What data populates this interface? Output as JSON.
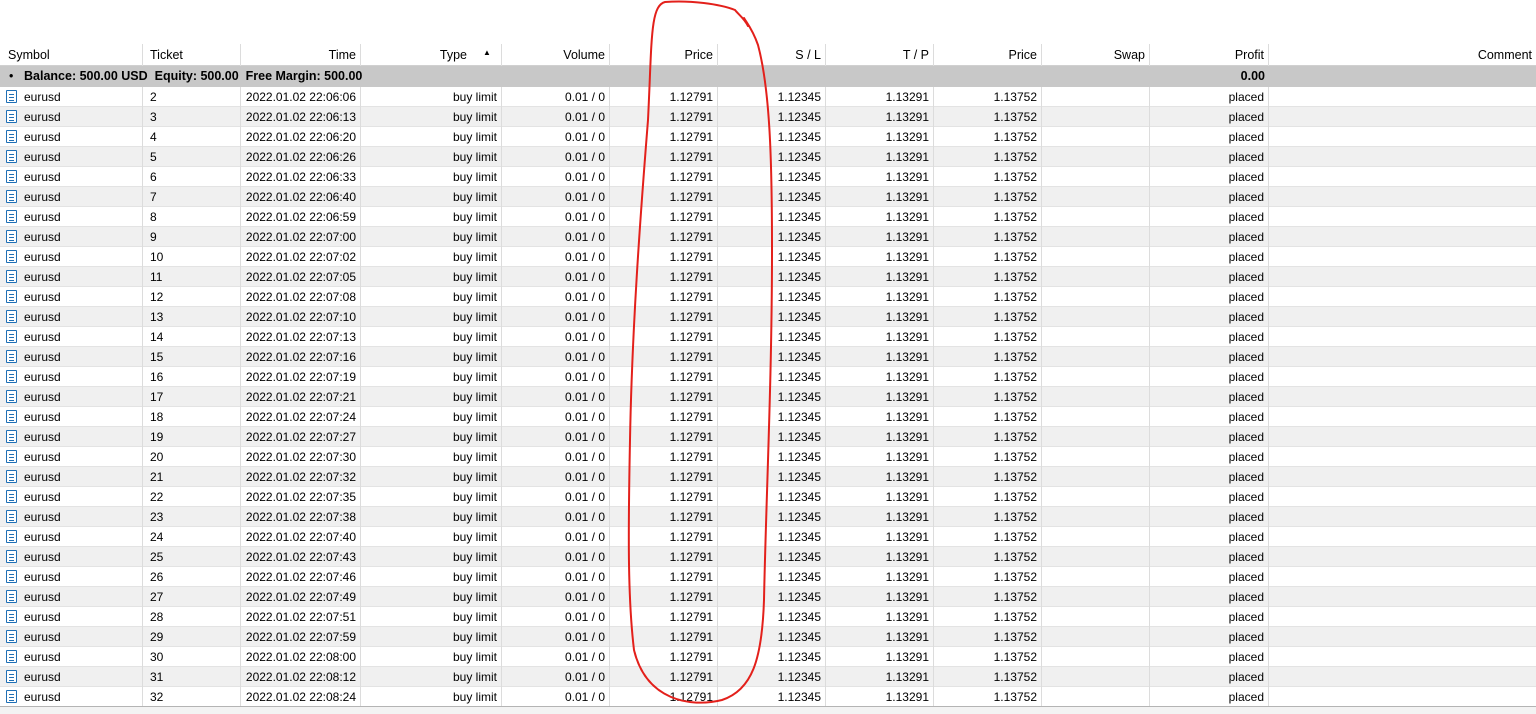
{
  "columns": {
    "symbol": "Symbol",
    "ticket": "Ticket",
    "time": "Time",
    "type": "Type",
    "volume": "Volume",
    "price": "Price",
    "sl": "S / L",
    "tp": "T / P",
    "price2": "Price",
    "swap": "Swap",
    "profit": "Profit",
    "comment": "Comment"
  },
  "summary": {
    "text": "Balance: 500.00 USD  Equity: 500.00  Free Margin: 500.00",
    "profit": "0.00"
  },
  "icons": {
    "row": "pending-order-icon",
    "bullet": "bullet-icon",
    "sort": "sort-ascending-icon"
  },
  "annotation_color": "#e3201b",
  "rows": [
    {
      "symbol": "eurusd",
      "ticket": "2",
      "time": "2022.01.02 22:06:06",
      "type": "buy limit",
      "volume": "0.01 / 0",
      "price": "1.12791",
      "sl": "1.12345",
      "tp": "1.13291",
      "price2": "1.13752",
      "swap": "",
      "profit": "placed",
      "comment": ""
    },
    {
      "symbol": "eurusd",
      "ticket": "3",
      "time": "2022.01.02 22:06:13",
      "type": "buy limit",
      "volume": "0.01 / 0",
      "price": "1.12791",
      "sl": "1.12345",
      "tp": "1.13291",
      "price2": "1.13752",
      "swap": "",
      "profit": "placed",
      "comment": ""
    },
    {
      "symbol": "eurusd",
      "ticket": "4",
      "time": "2022.01.02 22:06:20",
      "type": "buy limit",
      "volume": "0.01 / 0",
      "price": "1.12791",
      "sl": "1.12345",
      "tp": "1.13291",
      "price2": "1.13752",
      "swap": "",
      "profit": "placed",
      "comment": ""
    },
    {
      "symbol": "eurusd",
      "ticket": "5",
      "time": "2022.01.02 22:06:26",
      "type": "buy limit",
      "volume": "0.01 / 0",
      "price": "1.12791",
      "sl": "1.12345",
      "tp": "1.13291",
      "price2": "1.13752",
      "swap": "",
      "profit": "placed",
      "comment": ""
    },
    {
      "symbol": "eurusd",
      "ticket": "6",
      "time": "2022.01.02 22:06:33",
      "type": "buy limit",
      "volume": "0.01 / 0",
      "price": "1.12791",
      "sl": "1.12345",
      "tp": "1.13291",
      "price2": "1.13752",
      "swap": "",
      "profit": "placed",
      "comment": ""
    },
    {
      "symbol": "eurusd",
      "ticket": "7",
      "time": "2022.01.02 22:06:40",
      "type": "buy limit",
      "volume": "0.01 / 0",
      "price": "1.12791",
      "sl": "1.12345",
      "tp": "1.13291",
      "price2": "1.13752",
      "swap": "",
      "profit": "placed",
      "comment": ""
    },
    {
      "symbol": "eurusd",
      "ticket": "8",
      "time": "2022.01.02 22:06:59",
      "type": "buy limit",
      "volume": "0.01 / 0",
      "price": "1.12791",
      "sl": "1.12345",
      "tp": "1.13291",
      "price2": "1.13752",
      "swap": "",
      "profit": "placed",
      "comment": ""
    },
    {
      "symbol": "eurusd",
      "ticket": "9",
      "time": "2022.01.02 22:07:00",
      "type": "buy limit",
      "volume": "0.01 / 0",
      "price": "1.12791",
      "sl": "1.12345",
      "tp": "1.13291",
      "price2": "1.13752",
      "swap": "",
      "profit": "placed",
      "comment": ""
    },
    {
      "symbol": "eurusd",
      "ticket": "10",
      "time": "2022.01.02 22:07:02",
      "type": "buy limit",
      "volume": "0.01 / 0",
      "price": "1.12791",
      "sl": "1.12345",
      "tp": "1.13291",
      "price2": "1.13752",
      "swap": "",
      "profit": "placed",
      "comment": ""
    },
    {
      "symbol": "eurusd",
      "ticket": "11",
      "time": "2022.01.02 22:07:05",
      "type": "buy limit",
      "volume": "0.01 / 0",
      "price": "1.12791",
      "sl": "1.12345",
      "tp": "1.13291",
      "price2": "1.13752",
      "swap": "",
      "profit": "placed",
      "comment": ""
    },
    {
      "symbol": "eurusd",
      "ticket": "12",
      "time": "2022.01.02 22:07:08",
      "type": "buy limit",
      "volume": "0.01 / 0",
      "price": "1.12791",
      "sl": "1.12345",
      "tp": "1.13291",
      "price2": "1.13752",
      "swap": "",
      "profit": "placed",
      "comment": ""
    },
    {
      "symbol": "eurusd",
      "ticket": "13",
      "time": "2022.01.02 22:07:10",
      "type": "buy limit",
      "volume": "0.01 / 0",
      "price": "1.12791",
      "sl": "1.12345",
      "tp": "1.13291",
      "price2": "1.13752",
      "swap": "",
      "profit": "placed",
      "comment": ""
    },
    {
      "symbol": "eurusd",
      "ticket": "14",
      "time": "2022.01.02 22:07:13",
      "type": "buy limit",
      "volume": "0.01 / 0",
      "price": "1.12791",
      "sl": "1.12345",
      "tp": "1.13291",
      "price2": "1.13752",
      "swap": "",
      "profit": "placed",
      "comment": ""
    },
    {
      "symbol": "eurusd",
      "ticket": "15",
      "time": "2022.01.02 22:07:16",
      "type": "buy limit",
      "volume": "0.01 / 0",
      "price": "1.12791",
      "sl": "1.12345",
      "tp": "1.13291",
      "price2": "1.13752",
      "swap": "",
      "profit": "placed",
      "comment": ""
    },
    {
      "symbol": "eurusd",
      "ticket": "16",
      "time": "2022.01.02 22:07:19",
      "type": "buy limit",
      "volume": "0.01 / 0",
      "price": "1.12791",
      "sl": "1.12345",
      "tp": "1.13291",
      "price2": "1.13752",
      "swap": "",
      "profit": "placed",
      "comment": ""
    },
    {
      "symbol": "eurusd",
      "ticket": "17",
      "time": "2022.01.02 22:07:21",
      "type": "buy limit",
      "volume": "0.01 / 0",
      "price": "1.12791",
      "sl": "1.12345",
      "tp": "1.13291",
      "price2": "1.13752",
      "swap": "",
      "profit": "placed",
      "comment": ""
    },
    {
      "symbol": "eurusd",
      "ticket": "18",
      "time": "2022.01.02 22:07:24",
      "type": "buy limit",
      "volume": "0.01 / 0",
      "price": "1.12791",
      "sl": "1.12345",
      "tp": "1.13291",
      "price2": "1.13752",
      "swap": "",
      "profit": "placed",
      "comment": ""
    },
    {
      "symbol": "eurusd",
      "ticket": "19",
      "time": "2022.01.02 22:07:27",
      "type": "buy limit",
      "volume": "0.01 / 0",
      "price": "1.12791",
      "sl": "1.12345",
      "tp": "1.13291",
      "price2": "1.13752",
      "swap": "",
      "profit": "placed",
      "comment": ""
    },
    {
      "symbol": "eurusd",
      "ticket": "20",
      "time": "2022.01.02 22:07:30",
      "type": "buy limit",
      "volume": "0.01 / 0",
      "price": "1.12791",
      "sl": "1.12345",
      "tp": "1.13291",
      "price2": "1.13752",
      "swap": "",
      "profit": "placed",
      "comment": ""
    },
    {
      "symbol": "eurusd",
      "ticket": "21",
      "time": "2022.01.02 22:07:32",
      "type": "buy limit",
      "volume": "0.01 / 0",
      "price": "1.12791",
      "sl": "1.12345",
      "tp": "1.13291",
      "price2": "1.13752",
      "swap": "",
      "profit": "placed",
      "comment": ""
    },
    {
      "symbol": "eurusd",
      "ticket": "22",
      "time": "2022.01.02 22:07:35",
      "type": "buy limit",
      "volume": "0.01 / 0",
      "price": "1.12791",
      "sl": "1.12345",
      "tp": "1.13291",
      "price2": "1.13752",
      "swap": "",
      "profit": "placed",
      "comment": ""
    },
    {
      "symbol": "eurusd",
      "ticket": "23",
      "time": "2022.01.02 22:07:38",
      "type": "buy limit",
      "volume": "0.01 / 0",
      "price": "1.12791",
      "sl": "1.12345",
      "tp": "1.13291",
      "price2": "1.13752",
      "swap": "",
      "profit": "placed",
      "comment": ""
    },
    {
      "symbol": "eurusd",
      "ticket": "24",
      "time": "2022.01.02 22:07:40",
      "type": "buy limit",
      "volume": "0.01 / 0",
      "price": "1.12791",
      "sl": "1.12345",
      "tp": "1.13291",
      "price2": "1.13752",
      "swap": "",
      "profit": "placed",
      "comment": ""
    },
    {
      "symbol": "eurusd",
      "ticket": "25",
      "time": "2022.01.02 22:07:43",
      "type": "buy limit",
      "volume": "0.01 / 0",
      "price": "1.12791",
      "sl": "1.12345",
      "tp": "1.13291",
      "price2": "1.13752",
      "swap": "",
      "profit": "placed",
      "comment": ""
    },
    {
      "symbol": "eurusd",
      "ticket": "26",
      "time": "2022.01.02 22:07:46",
      "type": "buy limit",
      "volume": "0.01 / 0",
      "price": "1.12791",
      "sl": "1.12345",
      "tp": "1.13291",
      "price2": "1.13752",
      "swap": "",
      "profit": "placed",
      "comment": ""
    },
    {
      "symbol": "eurusd",
      "ticket": "27",
      "time": "2022.01.02 22:07:49",
      "type": "buy limit",
      "volume": "0.01 / 0",
      "price": "1.12791",
      "sl": "1.12345",
      "tp": "1.13291",
      "price2": "1.13752",
      "swap": "",
      "profit": "placed",
      "comment": ""
    },
    {
      "symbol": "eurusd",
      "ticket": "28",
      "time": "2022.01.02 22:07:51",
      "type": "buy limit",
      "volume": "0.01 / 0",
      "price": "1.12791",
      "sl": "1.12345",
      "tp": "1.13291",
      "price2": "1.13752",
      "swap": "",
      "profit": "placed",
      "comment": ""
    },
    {
      "symbol": "eurusd",
      "ticket": "29",
      "time": "2022.01.02 22:07:59",
      "type": "buy limit",
      "volume": "0.01 / 0",
      "price": "1.12791",
      "sl": "1.12345",
      "tp": "1.13291",
      "price2": "1.13752",
      "swap": "",
      "profit": "placed",
      "comment": ""
    },
    {
      "symbol": "eurusd",
      "ticket": "30",
      "time": "2022.01.02 22:08:00",
      "type": "buy limit",
      "volume": "0.01 / 0",
      "price": "1.12791",
      "sl": "1.12345",
      "tp": "1.13291",
      "price2": "1.13752",
      "swap": "",
      "profit": "placed",
      "comment": ""
    },
    {
      "symbol": "eurusd",
      "ticket": "31",
      "time": "2022.01.02 22:08:12",
      "type": "buy limit",
      "volume": "0.01 / 0",
      "price": "1.12791",
      "sl": "1.12345",
      "tp": "1.13291",
      "price2": "1.13752",
      "swap": "",
      "profit": "placed",
      "comment": ""
    },
    {
      "symbol": "eurusd",
      "ticket": "32",
      "time": "2022.01.02 22:08:24",
      "type": "buy limit",
      "volume": "0.01 / 0",
      "price": "1.12791",
      "sl": "1.12345",
      "tp": "1.13291",
      "price2": "1.13752",
      "swap": "",
      "profit": "placed",
      "comment": ""
    }
  ]
}
